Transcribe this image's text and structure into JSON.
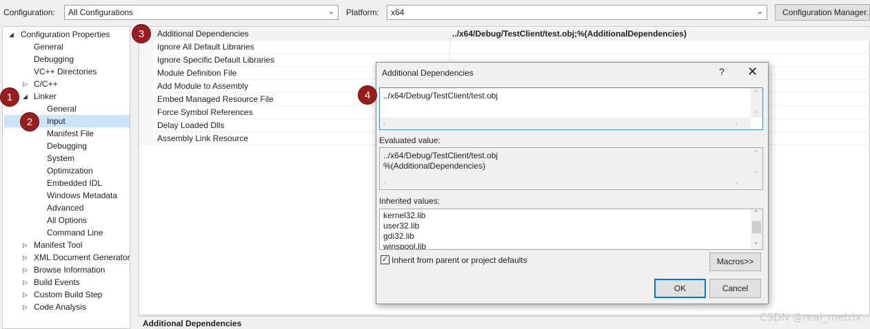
{
  "toolbar": {
    "configuration_label": "Configuration:",
    "configuration_value": "All Configurations",
    "platform_label": "Platform:",
    "platform_value": "x64",
    "config_manager_button": "Configuration Manager..."
  },
  "tree": {
    "items": [
      {
        "label": "Configuration Properties",
        "expander": "◢"
      },
      {
        "label": "General"
      },
      {
        "label": "Debugging"
      },
      {
        "label": "VC++ Directories"
      },
      {
        "label": "C/C++",
        "expander": "▷"
      },
      {
        "label": "Linker",
        "expander": "◢"
      },
      {
        "label": "General"
      },
      {
        "label": "Input"
      },
      {
        "label": "Manifest File"
      },
      {
        "label": "Debugging"
      },
      {
        "label": "System"
      },
      {
        "label": "Optimization"
      },
      {
        "label": "Embedded IDL"
      },
      {
        "label": "Windows Metadata"
      },
      {
        "label": "Advanced"
      },
      {
        "label": "All Options"
      },
      {
        "label": "Command Line"
      },
      {
        "label": "Manifest Tool",
        "expander": "▷"
      },
      {
        "label": "XML Document Generator",
        "expander": "▷"
      },
      {
        "label": "Browse Information",
        "expander": "▷"
      },
      {
        "label": "Build Events",
        "expander": "▷"
      },
      {
        "label": "Custom Build Step",
        "expander": "▷"
      },
      {
        "label": "Code Analysis",
        "expander": "▷"
      }
    ]
  },
  "grid": {
    "rows": [
      {
        "name": "Additional Dependencies",
        "value": "../x64/Debug/TestClient/test.obj;%(AdditionalDependencies)"
      },
      {
        "name": "Ignore All Default Libraries",
        "value": ""
      },
      {
        "name": "Ignore Specific Default Libraries",
        "value": ""
      },
      {
        "name": "Module Definition File",
        "value": ""
      },
      {
        "name": "Add Module to Assembly",
        "value": ""
      },
      {
        "name": "Embed Managed Resource File",
        "value": ""
      },
      {
        "name": "Force Symbol References",
        "value": ""
      },
      {
        "name": "Delay Loaded Dlls",
        "value": ""
      },
      {
        "name": "Assembly Link Resource",
        "value": ""
      }
    ],
    "description_title": "Additional Dependencies"
  },
  "badges": [
    "1",
    "2",
    "3",
    "4"
  ],
  "dialog": {
    "title": "Additional Dependencies",
    "help": "?",
    "close": "✕",
    "edit_value": "../x64/Debug/TestClient/test.obj",
    "evaluated_label": "Evaluated value:",
    "evaluated_lines": "../x64/Debug/TestClient/test.obj\n%(AdditionalDependencies)",
    "inherited_label": "Inherited values:",
    "inherited_lines": "kernel32.lib\nuser32.lib\ngdi32.lib\nwinspool.lib",
    "inherit_checkbox_label": "Inherit from parent or project defaults",
    "macros_button": "Macros>>",
    "ok_button": "OK",
    "cancel_button": "Cancel"
  },
  "watermark": "CSDN @real_metrix"
}
